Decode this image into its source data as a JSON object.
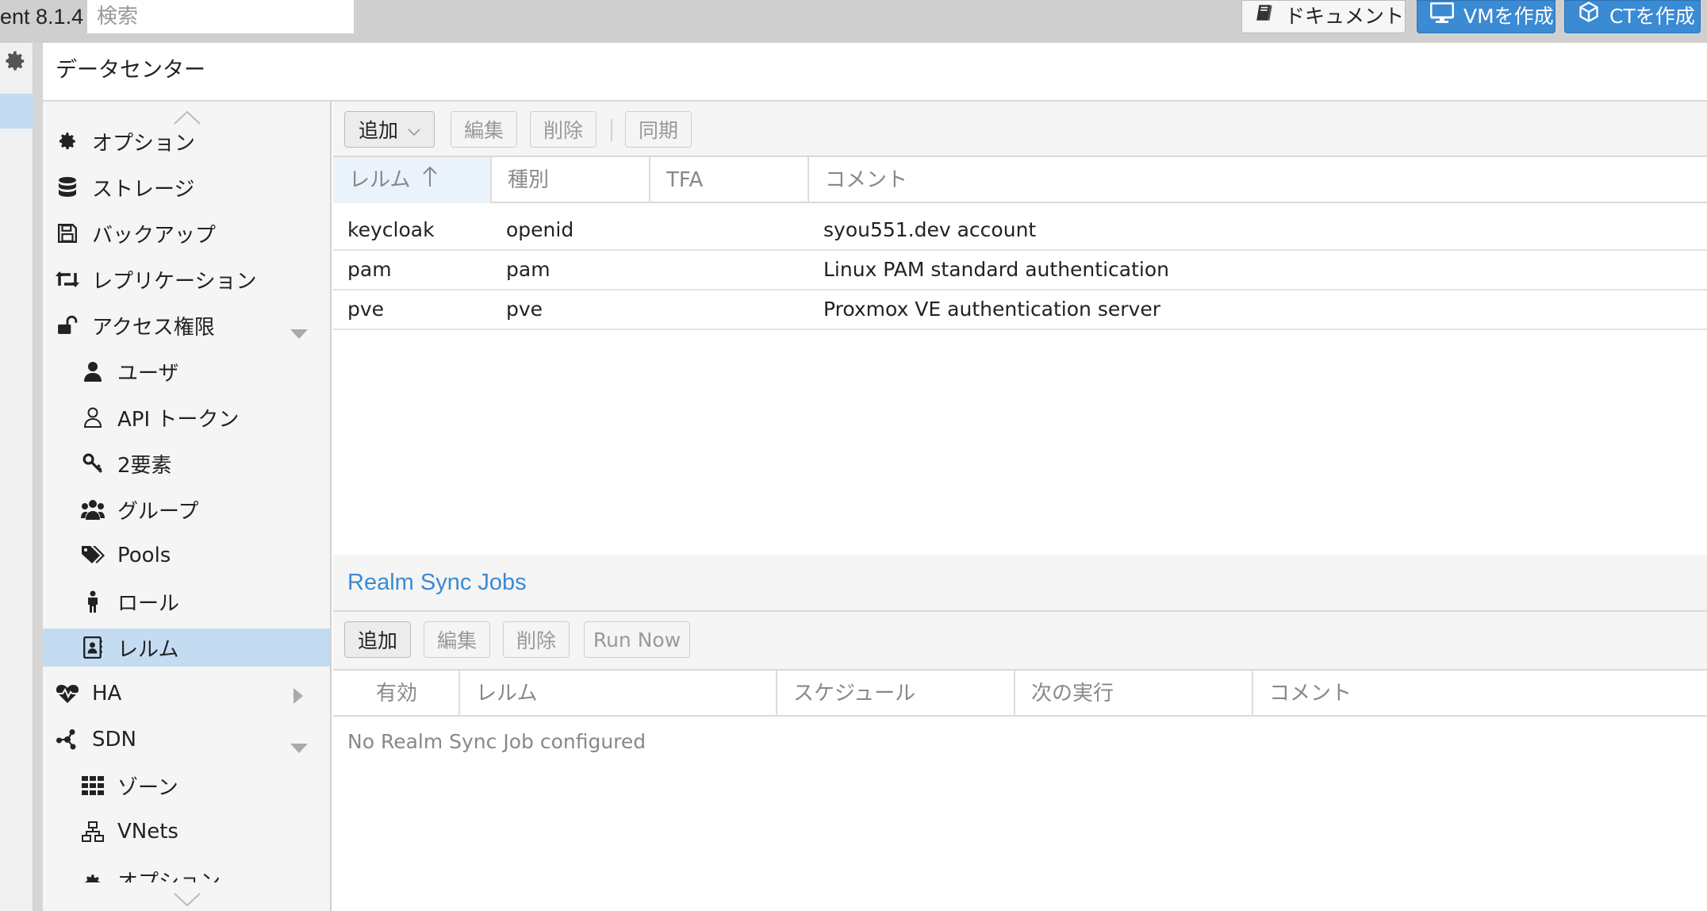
{
  "topbar": {
    "version": "ent 8.1.4",
    "search_placeholder": "検索",
    "docs_label": "ドキュメント",
    "create_vm_label": "VMを作成",
    "create_ct_label": "CTを作成"
  },
  "panel": {
    "title": "データセンター"
  },
  "nav": {
    "items": [
      {
        "label": "オプション",
        "icon": "gear-icon"
      },
      {
        "label": "ストレージ",
        "icon": "database-icon"
      },
      {
        "label": "バックアップ",
        "icon": "floppy-icon"
      },
      {
        "label": "レプリケーション",
        "icon": "retweet-icon"
      },
      {
        "label": "アクセス権限",
        "icon": "unlock-icon"
      },
      {
        "label": "ユーザ",
        "icon": "user-icon"
      },
      {
        "label": "API トークン",
        "icon": "user-outline-icon"
      },
      {
        "label": "2要素",
        "icon": "key-icon"
      },
      {
        "label": "グループ",
        "icon": "users-icon"
      },
      {
        "label": "Pools",
        "icon": "tags-icon"
      },
      {
        "label": "ロール",
        "icon": "male-icon"
      },
      {
        "label": "レルム",
        "icon": "address-book-icon"
      },
      {
        "label": "HA",
        "icon": "heartbeat-icon"
      },
      {
        "label": "SDN",
        "icon": "sdn-icon"
      },
      {
        "label": "ゾーン",
        "icon": "grid-icon"
      },
      {
        "label": "VNets",
        "icon": "sitemap-icon"
      },
      {
        "label": "オプション",
        "icon": "gear-icon"
      }
    ]
  },
  "realms": {
    "toolbar": {
      "add": "追加",
      "edit": "編集",
      "delete": "削除",
      "sync": "同期"
    },
    "columns": [
      "レルム",
      "種別",
      "TFA",
      "コメント"
    ],
    "rows": [
      {
        "realm": "keycloak",
        "type": "openid",
        "tfa": "",
        "comment": "syou551.dev account"
      },
      {
        "realm": "pam",
        "type": "pam",
        "tfa": "",
        "comment": "Linux PAM standard authentication"
      },
      {
        "realm": "pve",
        "type": "pve",
        "tfa": "",
        "comment": "Proxmox VE authentication server"
      }
    ]
  },
  "sync_jobs": {
    "title": "Realm Sync Jobs",
    "toolbar": {
      "add": "追加",
      "edit": "編集",
      "delete": "削除",
      "run_now": "Run Now"
    },
    "columns": [
      "有効",
      "レルム",
      "スケジュール",
      "次の実行",
      "コメント"
    ],
    "empty_text": "No Realm Sync Job configured"
  },
  "colors": {
    "accent": "#3a8ad4",
    "selected": "#c4dcf1"
  }
}
